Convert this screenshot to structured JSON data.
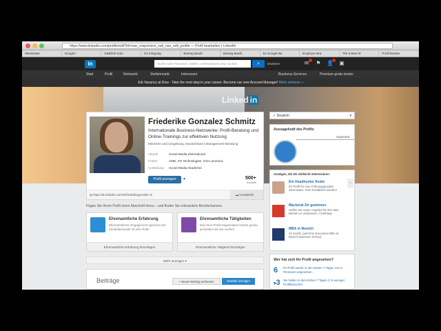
{
  "browser": {
    "url": "https://www.linkedin.com/profile/edit?trk=nav_responsive_sub_nav_edit_profile — Profil bearbeiten | LinkedIn",
    "bookmarks": [
      "Meetwaste",
      "Google+",
      "G&B/Kilt Solu",
      "G2 Integratg",
      "Beitrag Bearb",
      "Beitrag Bearb",
      "51 Google-Ba",
      "Employer Bra",
      "The 5 Best M",
      "Profil Bearbe"
    ]
  },
  "header": {
    "logo": "in",
    "search_placeholder": "Suche nach Personen, Stellen, Unternehmen usw. suchen",
    "search_icon": "search-icon",
    "advanced": "Erweitert",
    "nav": [
      "Start",
      "Profil",
      "Netzwerk",
      "Stellenmarkt",
      "Interessen"
    ],
    "nav_right": [
      "Business-Services",
      "Premium gratis testen"
    ],
    "job_banner": "Job Vacancy at Dow - Take the next step in your career. Become our new Account Manager!",
    "job_link": "Mehr erfahren »"
  },
  "hero": {
    "brand": "Linked",
    "brand_in": "in"
  },
  "profile": {
    "name": "Friederike Gonzalez Schmitz",
    "headline": "Internationale Business-Netzwerke: Profil-Beratung und Online-Trainings zur effektiven Nutzung",
    "location": "München und Umgebung, Deutschland  |  Management-Beratung",
    "current_label": "Aktuell",
    "current": "Social Media International",
    "past_label": "Früher",
    "past": "AMD, ATI Technologies, GSI Lumonics",
    "education_label": "Ausbildung",
    "education": "Social Media Akademie",
    "view_button": "Profil anzeigen",
    "connections": "500+",
    "connections_label": "Kontakte",
    "public_url": "https://de.linkedin.com/in/friederikegonzalez",
    "contact_info": "Kontaktinfo"
  },
  "add_section": {
    "heading": "Fügen Sie Ihrem Profil einen Abschnitt hinzu – und finden Sie relevantere Berufschancen.",
    "boxes": [
      {
        "title": "Ehrenamtliche Erfahrung",
        "desc": "Ehrenamtliches Engagement spielt bei der Kandidatenwahl oft eine Rolle.",
        "button": "Ehrenamtliche Erfahrung hinzufügen",
        "color": "#2b8fd1"
      },
      {
        "title": "Ehrenamtliche Tätigkeiten",
        "desc": "Eine Non-Profit-Organisation könnte genau jemanden wie Sie suchen.",
        "button": "Ehrenamtliche Tätigkeit hinzufügen",
        "color": "#7e4aa8"
      }
    ],
    "more": "Mehr anzeigen"
  },
  "posts": {
    "title": "Beiträge",
    "new_button": "+ Neuen Beitrag verfassen",
    "stats_button": "Statistik anzeigen"
  },
  "sidebar": {
    "language": "Deutsch",
    "strength_title": "Aussagekraft des Profils",
    "strength_level": "Superstar",
    "ads_title": "Anzeigen, die Sie vielleicht interessieren",
    "ads": [
      {
        "title": "Ein Headhunter findet",
        "desc": "Ihr Profil für eine Führungsposition interessant. Jetzt kontaktiert werden!"
      },
      {
        "title": "Macbook Air gewinnen",
        "desc": "Helfen Sie unser Angebot für den Mac Betrieb zu verbessern. #Umfrage"
      },
      {
        "title": "MBA in Munich",
        "desc": "24 month, part-time Executive MBA at Munich Business School."
      }
    ],
    "viewers_title": "Wer hat sich Ihr Profil angesehen?",
    "viewers": [
      {
        "num": "6",
        "text": "Ihr Profil wurde in den letzten 7 Tagen von 6 Personen angesehen."
      },
      {
        "num": "3",
        "text": "Sie hatten in den letzten 7 Tagen 3 % weniger Profilbesucher."
      }
    ]
  }
}
